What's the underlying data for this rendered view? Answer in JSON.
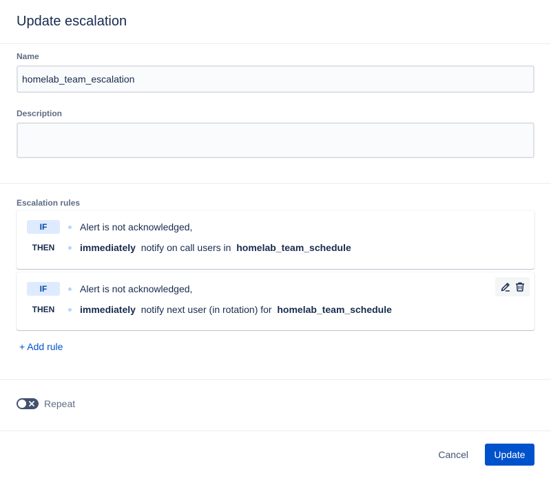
{
  "dialog": {
    "title": "Update escalation"
  },
  "form": {
    "name": {
      "label": "Name",
      "value": "homelab_team_escalation"
    },
    "description": {
      "label": "Description",
      "value": ""
    }
  },
  "rules": {
    "label": "Escalation rules",
    "items": [
      {
        "if_tag": "IF",
        "then_tag": "THEN",
        "condition": "Alert is not acknowledged,",
        "timing": "immediately",
        "action": "notify on call users in",
        "target": "homelab_team_schedule"
      },
      {
        "if_tag": "IF",
        "then_tag": "THEN",
        "condition": "Alert is not acknowledged,",
        "timing": "immediately",
        "action": "notify next user (in rotation) for",
        "target": "homelab_team_schedule"
      }
    ],
    "add_rule_label": "+ Add rule"
  },
  "repeat": {
    "label": "Repeat",
    "enabled": false
  },
  "footer": {
    "cancel_label": "Cancel",
    "update_label": "Update"
  },
  "icons": {
    "edit": "pencil-icon",
    "delete": "trash-icon",
    "toggle_off": "close-icon"
  },
  "colors": {
    "primary": "#0052cc",
    "if_tag_bg": "#deebff",
    "toggle_off": "#42526e"
  }
}
